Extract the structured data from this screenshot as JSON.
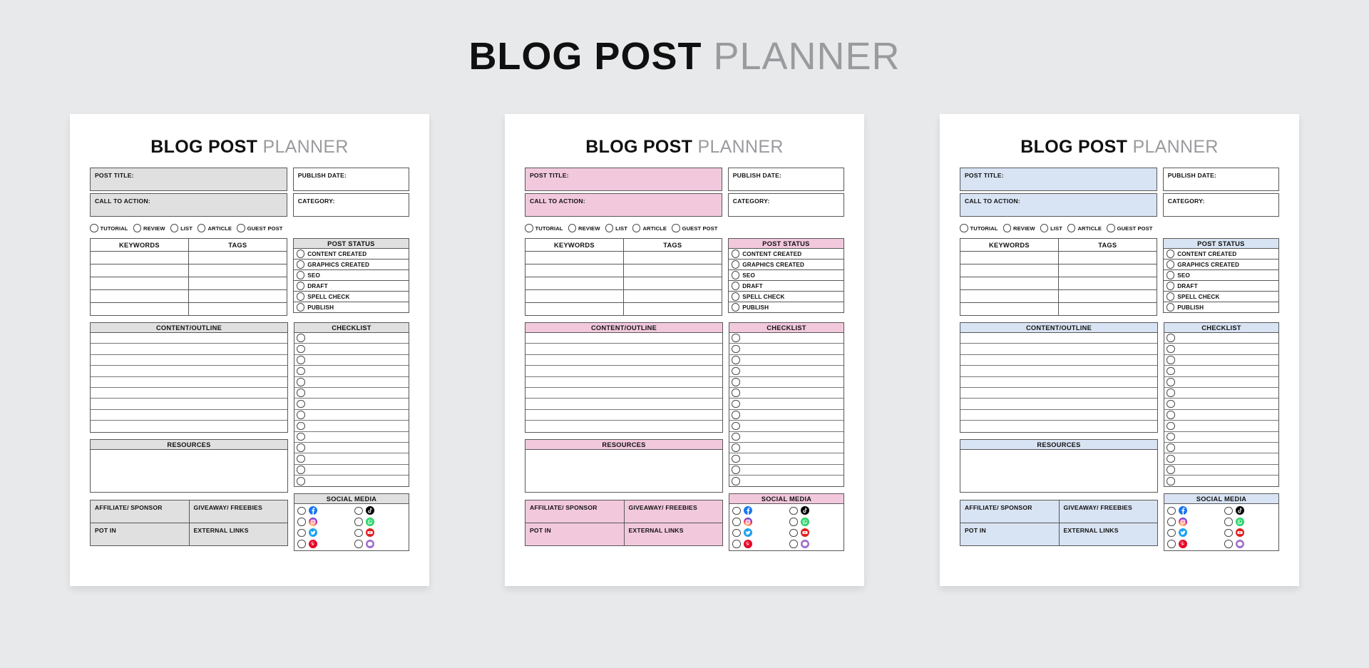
{
  "header": {
    "title_bold": "BLOG POST",
    "title_light": "PLANNER"
  },
  "card_title": {
    "bold": "BLOG POST",
    "light": "PLANNER"
  },
  "fields": {
    "post_title": "POST TITLE:",
    "call_to_action": "CALL TO ACTION:",
    "publish_date": "PUBLISH DATE:",
    "category": "CATEGORY:"
  },
  "post_types": [
    "TUTORIAL",
    "REVIEW",
    "LIST",
    "ARTICLE",
    "GUEST POST"
  ],
  "keywords_table": {
    "headers": [
      "KEYWORDS",
      "TAGS"
    ],
    "rows": 5
  },
  "post_status": {
    "title": "POST STATUS",
    "items": [
      "CONTENT CREATED",
      "GRAPHICS CREATED",
      "SEO",
      "DRAFT",
      "SPELL CHECK",
      "PUBLISH"
    ]
  },
  "content_outline": {
    "title": "CONTENT/OUTLINE",
    "rows": 9
  },
  "checklist": {
    "title": "CHECKLIST",
    "rows": 14
  },
  "resources": {
    "title": "RESOURCES"
  },
  "bottom_table": {
    "cells": [
      [
        "AFFILIATE/ SPONSOR",
        "GIVEAWAY/ FREEBIES"
      ],
      [
        "POT IN",
        "EXTERNAL LINKS"
      ]
    ]
  },
  "social_media": {
    "title": "SOCIAL MEDIA",
    "left": [
      "facebook-icon",
      "instagram-icon",
      "twitter-icon",
      "pinterest-icon"
    ],
    "right": [
      "tiktok-icon",
      "whatsapp-icon",
      "youtube-icon",
      "viber-icon"
    ]
  },
  "cards": [
    {
      "id": "card-gray",
      "accent": "#e0e0e0",
      "accent_name": "gray"
    },
    {
      "id": "card-pink",
      "accent": "#f2c8dd",
      "accent_name": "pink"
    },
    {
      "id": "card-blue",
      "accent": "#d8e3f3",
      "accent_name": "blue"
    }
  ],
  "colors": {
    "background": "#e7e9eb",
    "card": "#ffffff",
    "border": "#585858",
    "text": "#111111",
    "title_light": "#9a9b9e",
    "facebook": "#1877f2",
    "instagram": "#c13584",
    "twitter": "#1da1f2",
    "pinterest": "#e60023",
    "tiktok": "#010101",
    "whatsapp": "#25d366",
    "youtube": "#e02020",
    "viber": "#a06ecb"
  }
}
